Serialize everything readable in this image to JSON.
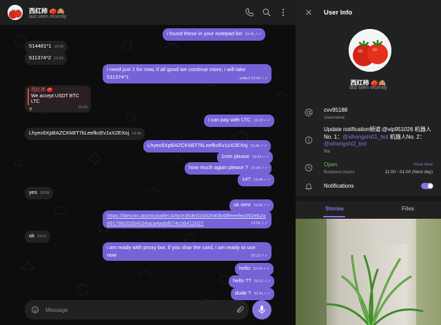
{
  "chat_header": {
    "name": "西红柿 🍅🙈",
    "status": "last seen recently",
    "icons": [
      "phone-icon",
      "search-icon",
      "more-vertical-icon"
    ]
  },
  "messages": {
    "m0": {
      "text": "i found these in your notepad list",
      "time": "19:41"
    },
    "m1": {
      "text": "514481*1",
      "time": "19:42"
    },
    "m2": {
      "text": "511374*2",
      "time": "19:43"
    },
    "m3": {
      "text": "i need just 1 for now, if all good we continue more, i will take 511374*1",
      "time": "19:43",
      "edited": "edited"
    },
    "m4": {
      "quote_name": "西红柿 🍅",
      "quote_text": "We accept USDT BTC LTC",
      "text": "?",
      "time": "19:43"
    },
    "m5": {
      "text": "i can pay with LTC",
      "time": "19:43"
    },
    "m6": {
      "text": "Lhyec6XpBAZCKkBT7kLeefkcEv1xX2EXoj",
      "time": "19:44"
    },
    "m7": {
      "text": "Lhyec6XpBAZCKkBT7kLeefkcEv1xX2EXoj",
      "time": "19:44"
    },
    "m8": {
      "text": "1min please",
      "time": "19:44"
    },
    "m9": {
      "text": "how much agian please ?",
      "time": "19:44"
    },
    "m10": {
      "text": "14?",
      "time": "19:44"
    },
    "m11": {
      "text": "yes",
      "time": "19:56"
    },
    "m12": {
      "text": "ok sent",
      "time": "19:56"
    },
    "m13": {
      "text": "https://litecoin.atomicwallet.io/tx/e35de315d2640b48feeefec092eb2a991788202b4034aca4aabf074c06412027",
      "time": "19:56"
    },
    "m14": {
      "text": "ok",
      "time": "19:57"
    },
    "m15": {
      "text": "i am ready with proxy bor, if you shar the card, i am ready to use now",
      "time": "20:12"
    },
    "m16": {
      "text": "hello",
      "time": "20:24"
    },
    "m17": {
      "text": "hello ??",
      "time": "20:31"
    },
    "m18": {
      "text": "dude ?",
      "time": "20:41"
    }
  },
  "composer": {
    "placeholder": "Message"
  },
  "info": {
    "title": "User Info",
    "name": "西红柿 🍅🙈",
    "status": "last seen recently",
    "username": "cvv95188",
    "username_label": "Username",
    "bio_part1": "Update notification频道:@vip951026 机器人No. 1：",
    "bio_mention1": "@xihongshi01_bot",
    "bio_part2": " 机器人No. 2：",
    "bio_mention2": "@xihongshi2_bot",
    "bio_label": "Bio",
    "hours_status": "Open",
    "local_time_label": "local time",
    "hours_label": "Business hours",
    "hours_value": "11:00 - 01:00 (Next day)",
    "notifications_label": "Notifications",
    "notifications_on": true,
    "tabs": [
      "Stories",
      "Files"
    ]
  },
  "colors": {
    "accent": "#8774e1",
    "outgoing_bubble": "#7763d7",
    "incoming_bubble": "#212121",
    "open_green": "#62c35a"
  }
}
